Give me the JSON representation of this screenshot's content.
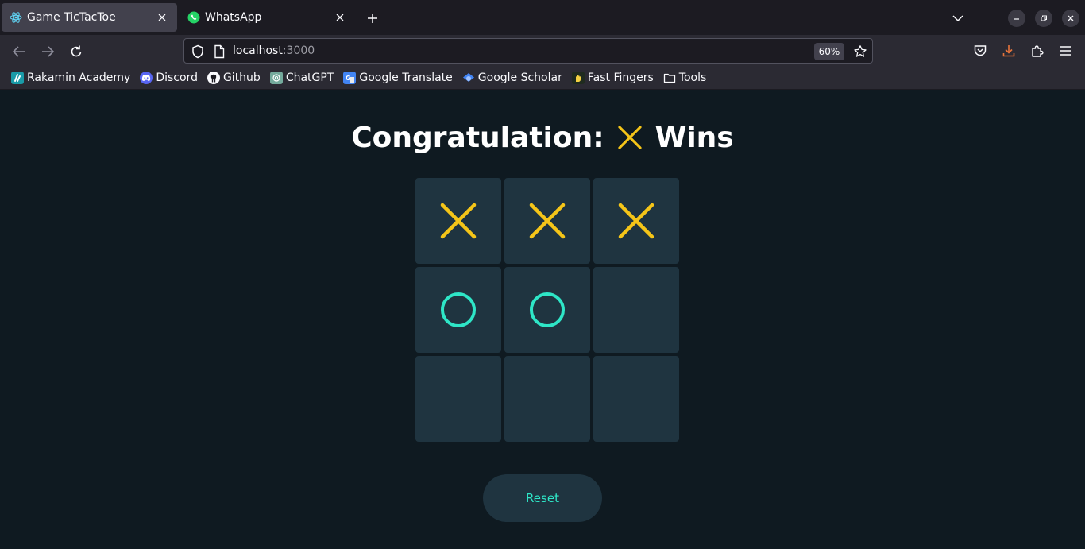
{
  "browser": {
    "tabs": [
      {
        "title": "Game TicTacToe",
        "active": true
      },
      {
        "title": "WhatsApp",
        "active": false
      }
    ],
    "url": {
      "host": "localhost",
      "port": ":3000"
    },
    "zoom": "60%",
    "bookmarks": [
      {
        "label": "Rakamin Academy",
        "icon": "rakamin-icon",
        "color": "#1a9ba8"
      },
      {
        "label": "Discord",
        "icon": "discord-icon",
        "color": "#5865f2"
      },
      {
        "label": "Github",
        "icon": "github-icon",
        "color": "#ffffff"
      },
      {
        "label": "ChatGPT",
        "icon": "chatgpt-icon",
        "color": "#74aa9c"
      },
      {
        "label": "Google Translate",
        "icon": "google-translate-icon",
        "color": "#4285f4"
      },
      {
        "label": "Google Scholar",
        "icon": "google-scholar-icon",
        "color": "#4285f4"
      },
      {
        "label": "Fast Fingers",
        "icon": "fast-fingers-icon",
        "color": "#f5d142"
      },
      {
        "label": "Tools",
        "icon": "folder-icon",
        "color": "#fbfbfe"
      }
    ]
  },
  "game": {
    "heading_prefix": "Congratulation:",
    "winner_mark": "X",
    "heading_suffix": "Wins",
    "board": [
      "X",
      "X",
      "X",
      "O",
      "O",
      "",
      "",
      "",
      ""
    ],
    "reset_label": "Reset",
    "colors": {
      "x": "#f5c518",
      "o": "#2ee6c7",
      "cell": "#1f3440",
      "background": "#0f1a21"
    }
  }
}
